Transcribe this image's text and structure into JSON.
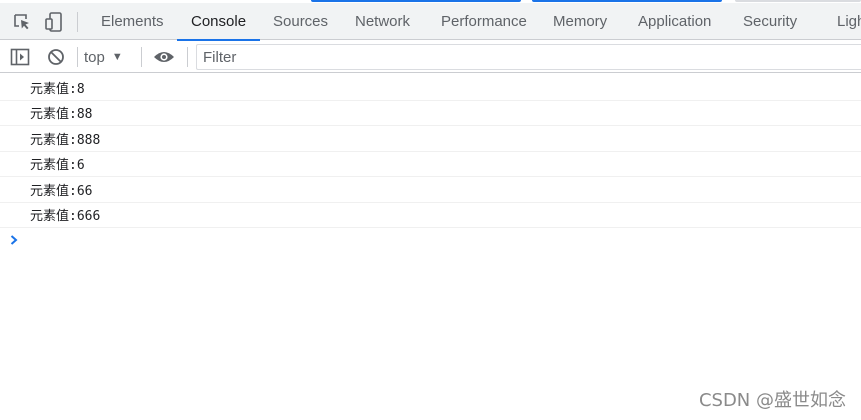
{
  "theme": {
    "accent": "#1a73e8",
    "tabbar_bg": "#f1f3f4",
    "border": "#cbcdd1"
  },
  "tabs": [
    {
      "label": "Elements"
    },
    {
      "label": "Console",
      "active": true
    },
    {
      "label": "Sources"
    },
    {
      "label": "Network"
    },
    {
      "label": "Performance"
    },
    {
      "label": "Memory"
    },
    {
      "label": "Application"
    },
    {
      "label": "Security"
    },
    {
      "label": "Ligh"
    }
  ],
  "toolbar": {
    "context": "top",
    "filter_placeholder": "Filter"
  },
  "console_lines": [
    "元素值:8",
    "元素值:88",
    "元素值:888",
    "元素值:6",
    "元素值:66",
    "元素值:666"
  ],
  "icons": {
    "inspect": "inspect-element-icon",
    "device": "device-toolbar-icon",
    "sidebar": "show-sidebar-icon",
    "clear": "clear-console-icon",
    "live": "eye-icon",
    "prompt": "chevron-right-icon"
  },
  "watermark": "CSDN @盛世如念"
}
